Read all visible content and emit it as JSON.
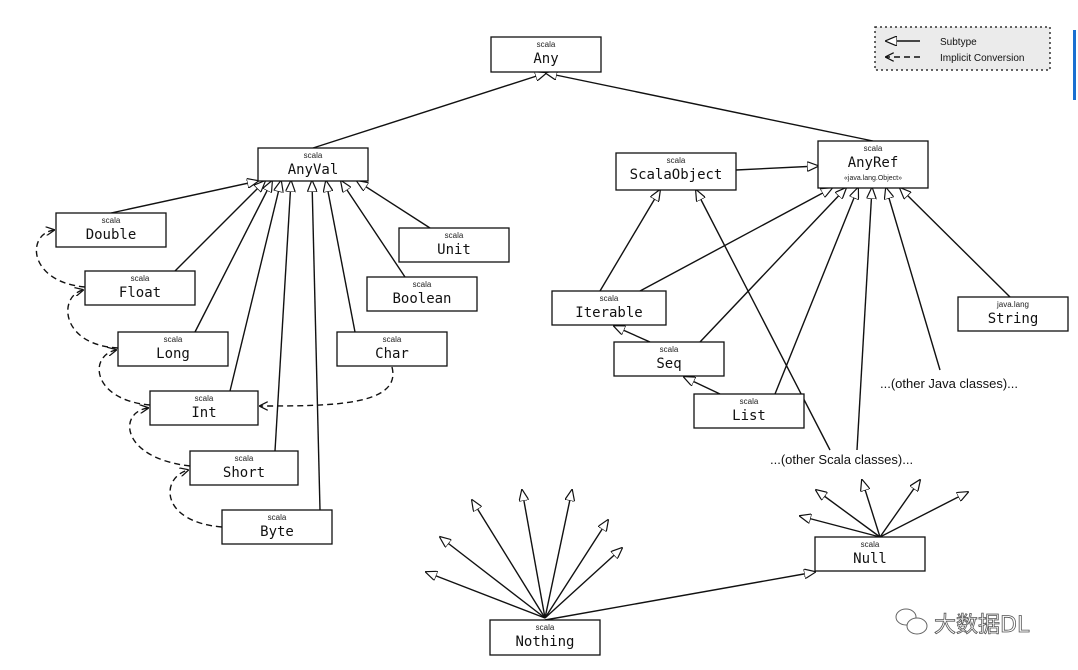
{
  "legend": {
    "subtype": "Subtype",
    "implicit": "Implicit Conversion"
  },
  "nodes": {
    "any": {
      "pkg": "scala",
      "name": "Any"
    },
    "anyval": {
      "pkg": "scala",
      "name": "AnyVal"
    },
    "anyref": {
      "pkg": "scala",
      "name": "AnyRef",
      "sub": "«java.lang.Object»"
    },
    "scalaobject": {
      "pkg": "scala",
      "name": "ScalaObject"
    },
    "double": {
      "pkg": "scala",
      "name": "Double"
    },
    "float": {
      "pkg": "scala",
      "name": "Float"
    },
    "long": {
      "pkg": "scala",
      "name": "Long"
    },
    "int": {
      "pkg": "scala",
      "name": "Int"
    },
    "short": {
      "pkg": "scala",
      "name": "Short"
    },
    "byte": {
      "pkg": "scala",
      "name": "Byte"
    },
    "unit": {
      "pkg": "scala",
      "name": "Unit"
    },
    "boolean": {
      "pkg": "scala",
      "name": "Boolean"
    },
    "char": {
      "pkg": "scala",
      "name": "Char"
    },
    "iterable": {
      "pkg": "scala",
      "name": "Iterable"
    },
    "seq": {
      "pkg": "scala",
      "name": "Seq"
    },
    "list": {
      "pkg": "scala",
      "name": "List"
    },
    "string": {
      "pkg": "java.lang",
      "name": "String"
    },
    "null": {
      "pkg": "scala",
      "name": "Null"
    },
    "nothing": {
      "pkg": "scala",
      "name": "Nothing"
    }
  },
  "labels": {
    "other_java": "...(other Java classes)...",
    "other_scala": "...(other Scala classes)..."
  },
  "watermark": "大数据DL",
  "accent_color": "#1a6fd1"
}
